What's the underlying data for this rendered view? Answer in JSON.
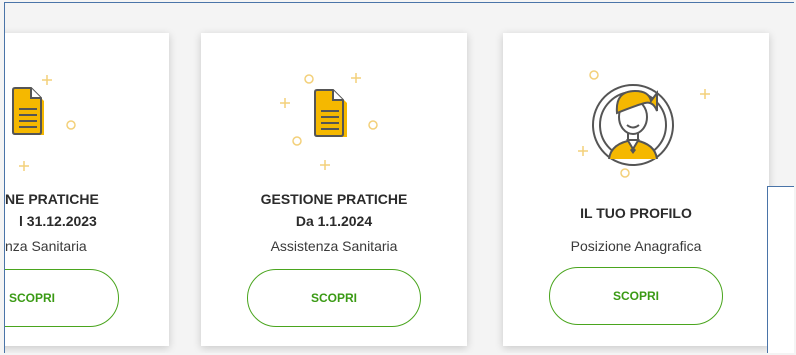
{
  "cards": [
    {
      "icon": "document-icon",
      "title_line1": "NE PRATICHE",
      "title_line2": "l 31.12.2023",
      "subtitle": "nza Sanitaria",
      "button": "SCOPRI"
    },
    {
      "icon": "document-icon",
      "title_line1": "GESTIONE PRATICHE",
      "title_line2": "Da 1.1.2024",
      "subtitle": "Assistenza Sanitaria",
      "button": "SCOPRI"
    },
    {
      "icon": "user-profile-icon",
      "title_line1": "IL TUO PROFILO",
      "subtitle": "Posizione Anagrafica",
      "button": "SCOPRI"
    }
  ],
  "colors": {
    "accent_green": "#3a9a14",
    "icon_yellow": "#f5b800",
    "frame_blue": "#4a74a8"
  }
}
